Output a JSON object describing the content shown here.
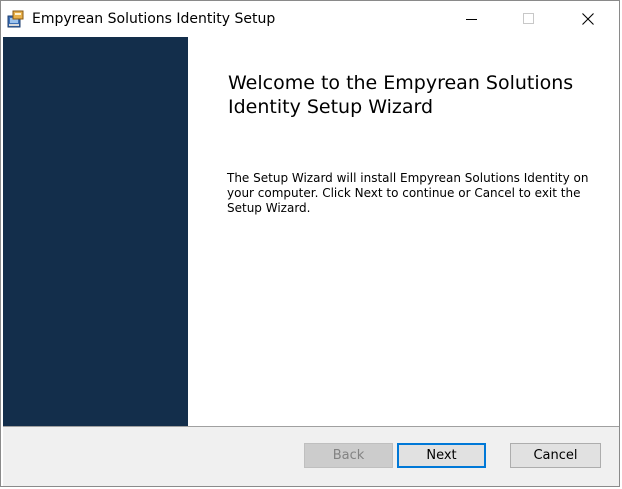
{
  "window": {
    "title": "Empyrean Solutions Identity Setup",
    "minimize_icon": "minimize-icon",
    "maximize_icon": "maximize-icon",
    "close_icon": "close-icon",
    "app_icon": "installer-icon"
  },
  "wizard": {
    "heading": "Welcome to the Empyrean Solutions Identity Setup Wizard",
    "body": "The Setup Wizard will install Empyrean Solutions Identity on your computer. Click Next to continue or Cancel to exit the Setup Wizard."
  },
  "buttons": {
    "back_label": "Back",
    "next_label": "Next",
    "cancel_label": "Cancel"
  },
  "colors": {
    "banner": "#132e4b",
    "focus_accent": "#0078d7",
    "footer": "#f0f0f0"
  }
}
